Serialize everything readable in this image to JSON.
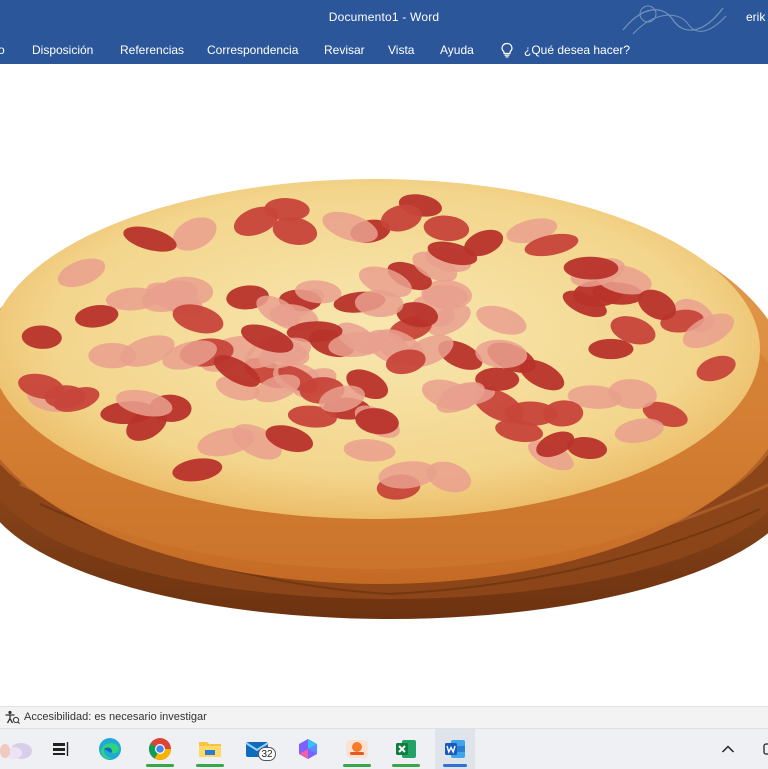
{
  "window": {
    "title": "Documento1  -  Word",
    "user": "erik"
  },
  "ribbon": {
    "tabs": [
      {
        "label": "o"
      },
      {
        "label": "Disposición"
      },
      {
        "label": "Referencias"
      },
      {
        "label": "Correspondencia"
      },
      {
        "label": "Revisar"
      },
      {
        "label": "Vista"
      },
      {
        "label": "Ayuda"
      }
    ],
    "tell_me": "¿Qué desea hacer?",
    "tell_me_icon": "lightbulb-icon"
  },
  "document": {
    "image": "pepperoni-ham-pizza-on-wooden-board"
  },
  "statusbar": {
    "accessibility": "Accesibilidad: es necesario investigar"
  },
  "taskbar": {
    "mail_badge": "32",
    "apps": [
      "widgets",
      "task-view",
      "edge",
      "chrome",
      "file-explorer",
      "mail",
      "copilot",
      "photos",
      "excel",
      "word"
    ]
  },
  "colors": {
    "word_blue": "#2b579a",
    "status_bg": "#f3f3f3",
    "taskbar_bg": "#eef0f4"
  }
}
